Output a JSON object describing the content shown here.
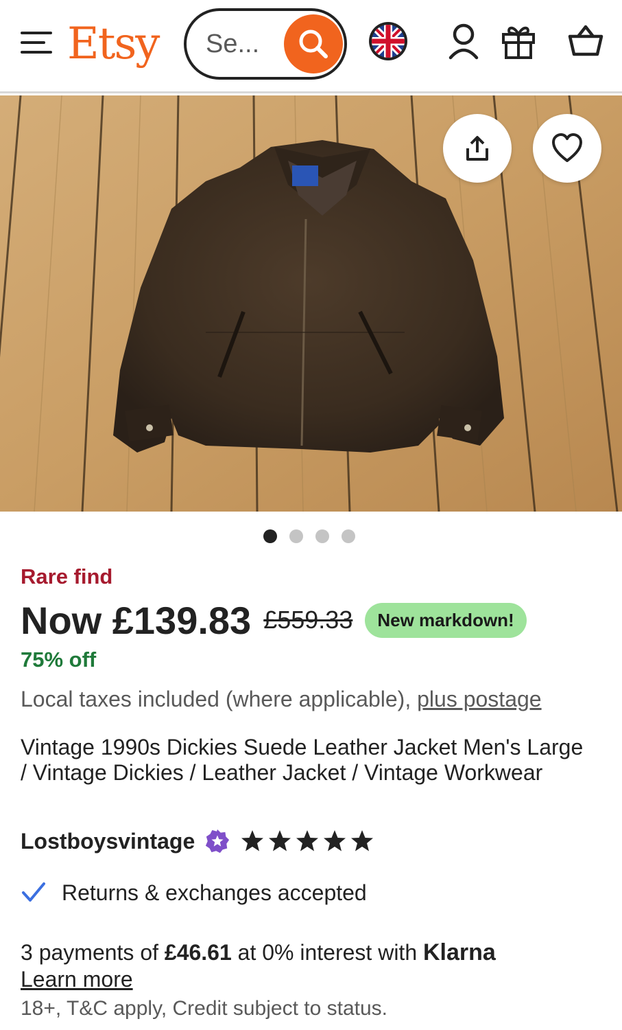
{
  "header": {
    "logo": "Etsy",
    "search_placeholder": "Se..."
  },
  "listing": {
    "rare_find": "Rare find",
    "price_now": "Now £139.83",
    "price_original": "£559.33",
    "markdown_badge": "New markdown!",
    "discount": "75% off",
    "taxes_text": "Local taxes included (where applicable), ",
    "postage_link": "plus postage",
    "title": "Vintage 1990s Dickies Suede Leather Jacket Men's Large / Vintage Dickies / Leather Jacket / Vintage Workwear",
    "shop_name": "Lostboysvintage",
    "rating": 5,
    "returns": "Returns & exchanges accepted",
    "image_count": 4,
    "active_image": 1
  },
  "klarna": {
    "prefix": "3 payments of ",
    "amount": "£46.61",
    "middle": " at 0% interest with ",
    "brand": "Klarna",
    "learn_more": "Learn more",
    "fine_print": "18+, T&C apply, Credit subject to status."
  },
  "colors": {
    "brand": "#f1641e",
    "rare_find": "#a61a2e",
    "discount": "#1f7a3a",
    "markdown_badge": "#9ee39b",
    "check": "#3b6fe0",
    "star_seller_badge": "#7f4fc9"
  },
  "icons": {
    "menu": "menu-icon",
    "search": "search-icon",
    "region": "uk-flag-icon",
    "account": "user-icon",
    "gift": "gift-icon",
    "cart": "basket-icon",
    "share": "share-icon",
    "favorite": "heart-icon",
    "star": "star-icon",
    "badge": "star-seller-badge-icon",
    "check": "check-icon"
  }
}
